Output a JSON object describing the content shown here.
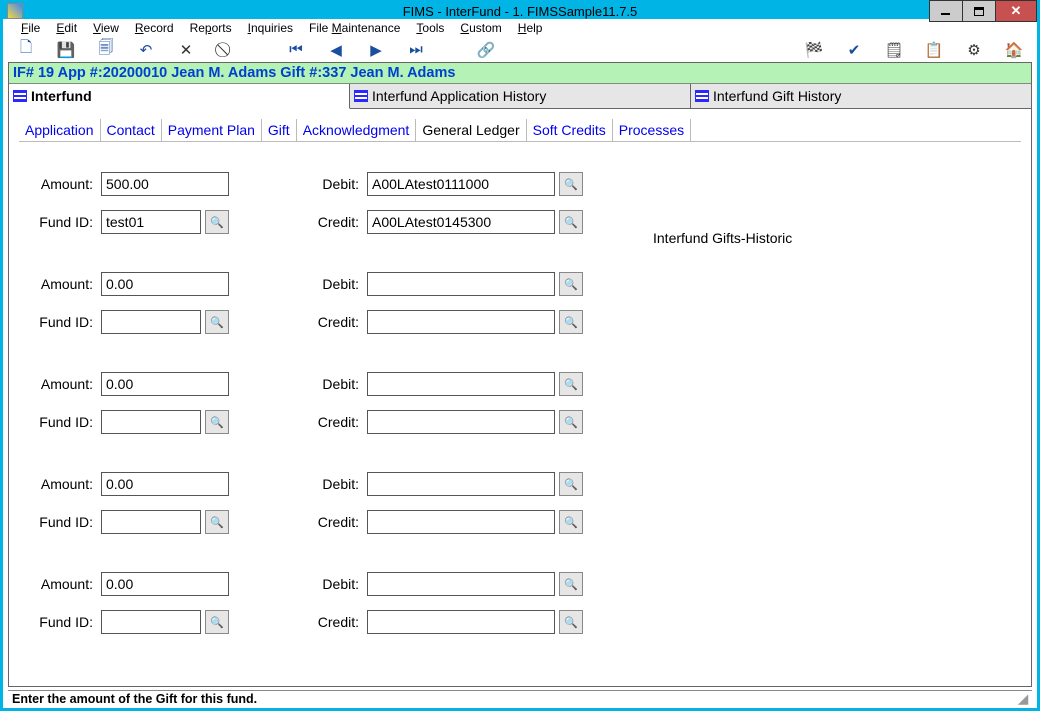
{
  "window": {
    "title": "FIMS - InterFund - 1. FIMSSample11.7.5"
  },
  "menus": [
    "File",
    "Edit",
    "View",
    "Record",
    "Reports",
    "Inquiries",
    "File Maintenance",
    "Tools",
    "Custom",
    "Help"
  ],
  "context_bar": "IF# 19 App #:20200010 Jean M. Adams   Gift #:337 Jean M. Adams",
  "main_tabs": {
    "t0": "Interfund",
    "t1": "Interfund Application History",
    "t2": "Interfund Gift History"
  },
  "sub_tabs": {
    "t0": "Application",
    "t1": "Contact",
    "t2": "Payment Plan",
    "t3": "Gift",
    "t4": "Acknowledgment",
    "t5": "General Ledger",
    "t6": "Soft Credits",
    "t7": "Processes"
  },
  "labels": {
    "amount": "Amount:",
    "fund_id": "Fund ID:",
    "debit": "Debit:",
    "credit": "Credit:"
  },
  "rows": [
    {
      "amount": "500.00",
      "fund_id": "test01",
      "debit": "A00LAtest0111000",
      "credit": "A00LAtest0145300"
    },
    {
      "amount": "0.00",
      "fund_id": "",
      "debit": "",
      "credit": ""
    },
    {
      "amount": "0.00",
      "fund_id": "",
      "debit": "",
      "credit": ""
    },
    {
      "amount": "0.00",
      "fund_id": "",
      "debit": "",
      "credit": ""
    },
    {
      "amount": "0.00",
      "fund_id": "",
      "debit": "",
      "credit": ""
    }
  ],
  "note": "Interfund Gifts-Historic",
  "status": "Enter the amount of the Gift for this fund."
}
